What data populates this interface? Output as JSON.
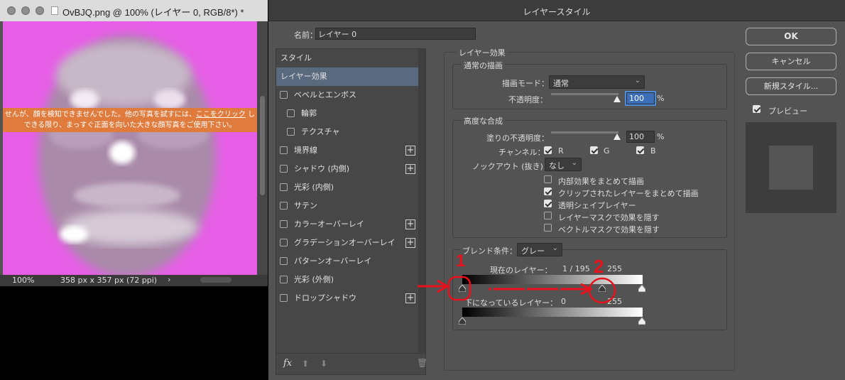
{
  "document": {
    "title": "OvBJQ.png @ 100% (レイヤー 0, RGB/8*) *",
    "zoom": "100%",
    "dimensions": "358 px x 357 px (72 ppi)",
    "status_arrow": "›",
    "warning_line1_pre": "せんが、顔を検知できませんでした。他の写真を試すには、",
    "warning_link": "ここをクリック",
    "warning_line1_post": " し",
    "warning_line2": "できる限り、まっすぐ正面を向いた大きな顔写真をご使用下さい。",
    "canvas_color": "#e65ee6"
  },
  "dialog": {
    "title": "レイヤースタイル",
    "name_label": "名前：",
    "name_value": "レイヤー 0",
    "styles": [
      {
        "label": "スタイル",
        "checkbox": false,
        "plus": false,
        "indent": 0,
        "selected": false
      },
      {
        "label": "レイヤー効果",
        "checkbox": false,
        "plus": false,
        "indent": 0,
        "selected": true
      },
      {
        "label": "ベベルとエンボス",
        "checkbox": true,
        "plus": false,
        "indent": 0,
        "selected": false
      },
      {
        "label": "輪郭",
        "checkbox": true,
        "plus": false,
        "indent": 1,
        "selected": false
      },
      {
        "label": "テクスチャ",
        "checkbox": true,
        "plus": false,
        "indent": 1,
        "selected": false
      },
      {
        "label": "境界線",
        "checkbox": true,
        "plus": true,
        "indent": 0,
        "selected": false
      },
      {
        "label": "シャドウ (内側)",
        "checkbox": true,
        "plus": true,
        "indent": 0,
        "selected": false
      },
      {
        "label": "光彩 (内側)",
        "checkbox": true,
        "plus": false,
        "indent": 0,
        "selected": false
      },
      {
        "label": "サテン",
        "checkbox": true,
        "plus": false,
        "indent": 0,
        "selected": false
      },
      {
        "label": "カラーオーバーレイ",
        "checkbox": true,
        "plus": true,
        "indent": 0,
        "selected": false
      },
      {
        "label": "グラデーションオーバーレイ",
        "checkbox": true,
        "plus": true,
        "indent": 0,
        "selected": false
      },
      {
        "label": "パターンオーバーレイ",
        "checkbox": true,
        "plus": false,
        "indent": 0,
        "selected": false
      },
      {
        "label": "光彩 (外側)",
        "checkbox": true,
        "plus": false,
        "indent": 0,
        "selected": false
      },
      {
        "label": "ドロップシャドウ",
        "checkbox": true,
        "plus": true,
        "indent": 0,
        "selected": false
      }
    ],
    "bottom": {
      "fx": "fx",
      "up": "⬆",
      "down": "⬇",
      "trash": "🗑"
    },
    "layer_effects": {
      "title": "レイヤー効果",
      "normal_blend_title": "通常の描画",
      "blend_mode_label": "描画モード：",
      "blend_mode_value": "通常",
      "opacity_label": "不透明度：",
      "opacity_value": "100",
      "opacity_unit": "%",
      "advanced_title": "高度な合成",
      "fill_opacity_label": "塗りの不透明度：",
      "fill_opacity_value": "100",
      "fill_opacity_unit": "%",
      "channels_label": "チャンネル：",
      "channel_r": "R",
      "channel_g": "G",
      "channel_b": "B",
      "knockout_label": "ノックアウト (抜き)：",
      "knockout_value": "なし",
      "options": [
        {
          "label": "内部効果をまとめて描画",
          "checked": false
        },
        {
          "label": "クリップされたレイヤーをまとめて描画",
          "checked": true
        },
        {
          "label": "透明シェイプレイヤー",
          "checked": true
        },
        {
          "label": "レイヤーマスクで効果を隠す",
          "checked": false
        },
        {
          "label": "ベクトルマスクで効果を隠す",
          "checked": false
        }
      ],
      "blend_if_label": "ブレンド条件：",
      "blend_if_value": "グレー",
      "this_layer_label": "現在のレイヤー：",
      "this_layer_values": "1  /  195",
      "this_layer_max": "255",
      "underlying_label": "下になっているレイヤー：",
      "underlying_min": "0",
      "underlying_max": "255"
    },
    "buttons": {
      "ok": "OK",
      "cancel": "キャンセル",
      "new_style": "新規スタイル...",
      "preview_label": "プレビュー"
    },
    "annotations": {
      "num1": "1",
      "num2": "2"
    }
  }
}
